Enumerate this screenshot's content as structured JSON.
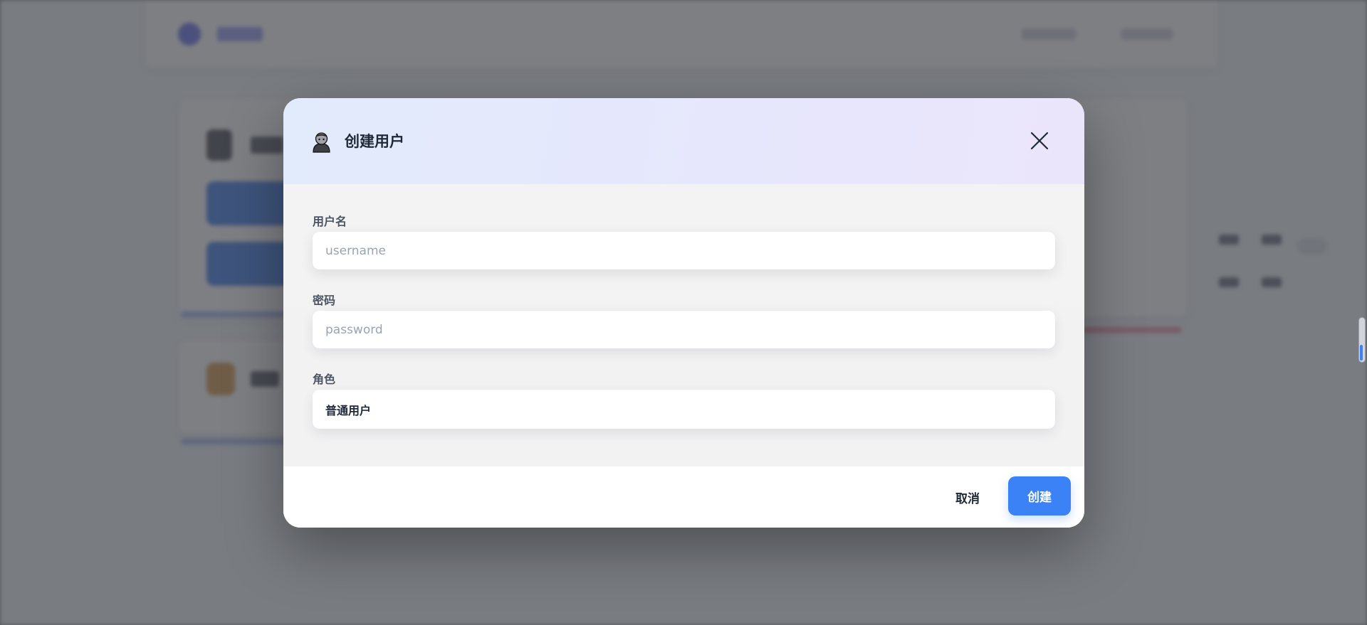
{
  "modal": {
    "title": "创建用户",
    "icon": "user-icon",
    "close_icon": "close-icon",
    "fields": {
      "username": {
        "label": "用户名",
        "placeholder": "username",
        "value": ""
      },
      "password": {
        "label": "密码",
        "placeholder": "password",
        "value": ""
      },
      "role": {
        "label": "角色",
        "value": "普通用户"
      }
    },
    "buttons": {
      "cancel": "取消",
      "create": "创建"
    }
  },
  "colors": {
    "primary": "#3b82f6",
    "overlay": "#46484e"
  }
}
